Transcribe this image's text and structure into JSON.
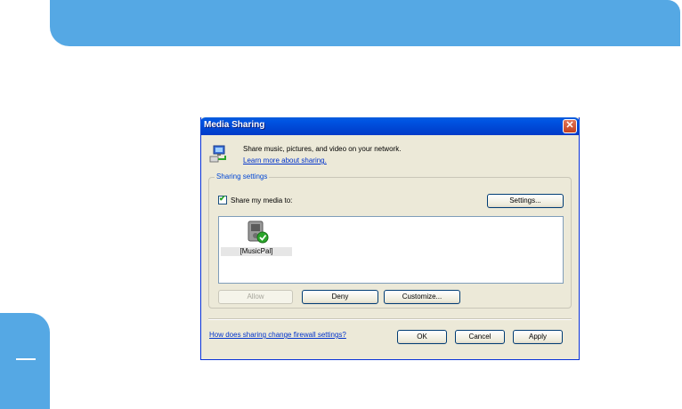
{
  "dialog": {
    "title": "Media Sharing",
    "close_glyph": "✕",
    "intro_text": "Share music, pictures, and video on your network.",
    "learn_more_link": "Learn more about sharing.",
    "group_label": "Sharing settings",
    "share_checkbox": {
      "label": "Share my media to:",
      "checked": true,
      "glyph": "✔"
    },
    "settings_button": "Settings...",
    "device": {
      "label": "[MusicPal]",
      "icon": "media-device-icon"
    },
    "allow_button": "Allow",
    "deny_button": "Deny",
    "customize_button": "Customize...",
    "firewall_link": "How does sharing change firewall settings?",
    "ok_button": "OK",
    "cancel_button": "Cancel",
    "apply_button": "Apply"
  },
  "colors": {
    "accent_blue": "#55a8e4",
    "title_bar": "#0054e3",
    "dialog_bg": "#ece9d8",
    "link": "#0033cc"
  },
  "icons": [
    "network-share-icon",
    "media-device-icon",
    "close-icon",
    "checkmark-icon"
  ]
}
